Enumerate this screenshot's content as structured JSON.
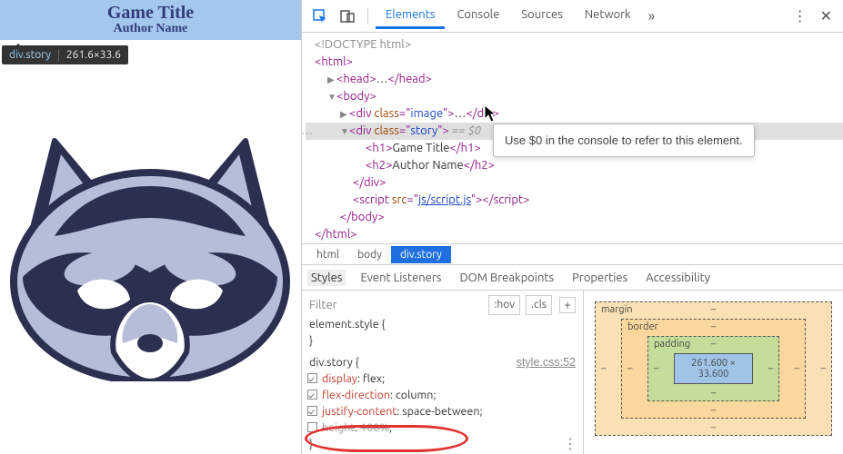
{
  "page": {
    "title": "Game Title",
    "author": "Author Name"
  },
  "measure_chip": {
    "selector_tag": "div",
    "selector_class": ".story",
    "dimensions": "261.6×33.6"
  },
  "devtools": {
    "tabs": {
      "elements": "Elements",
      "console": "Console",
      "sources": "Sources",
      "network": "Network"
    },
    "dom": {
      "doctype": "<!DOCTYPE html>",
      "html_open": "html",
      "head_open": "head",
      "head_ell": "…",
      "head_close": "head",
      "body_open": "body",
      "div_image_class": "image",
      "div_story_class": "story",
      "h1_text": "Game Title",
      "h2_text": "Author Name",
      "script_src": "js/script.js",
      "eq_zero": "== $0",
      "tooltip": "Use $0 in the console to refer to this element."
    },
    "breadcrumbs": {
      "b1": "html",
      "b2": "body",
      "b3": "div.story"
    },
    "styles_tabs": {
      "styles": "Styles",
      "event": "Event Listeners",
      "dom": "DOM Breakpoints",
      "props": "Properties",
      "acc": "Accessibility"
    },
    "styles": {
      "filter_placeholder": "Filter",
      "hov": ":hov",
      "cls": ".cls",
      "element_style_sel": "element.style {",
      "element_style_close": "}",
      "rule_sel": "div.story {",
      "rule_link": "style.css:52",
      "p_display_name": "display",
      "p_display_val": "flex",
      "p_flexdir_name": "flex-direction",
      "p_flexdir_val": "column",
      "p_justify_name": "justify-content",
      "p_justify_val": "space-between",
      "p_height_name": "height",
      "p_height_val": "100%",
      "rule_close": "}"
    },
    "boxmodel": {
      "margin_label": "margin",
      "border_label": "border",
      "padding_label": "padding",
      "content_dims": "261.600 × 33.600",
      "dash": "–"
    }
  }
}
